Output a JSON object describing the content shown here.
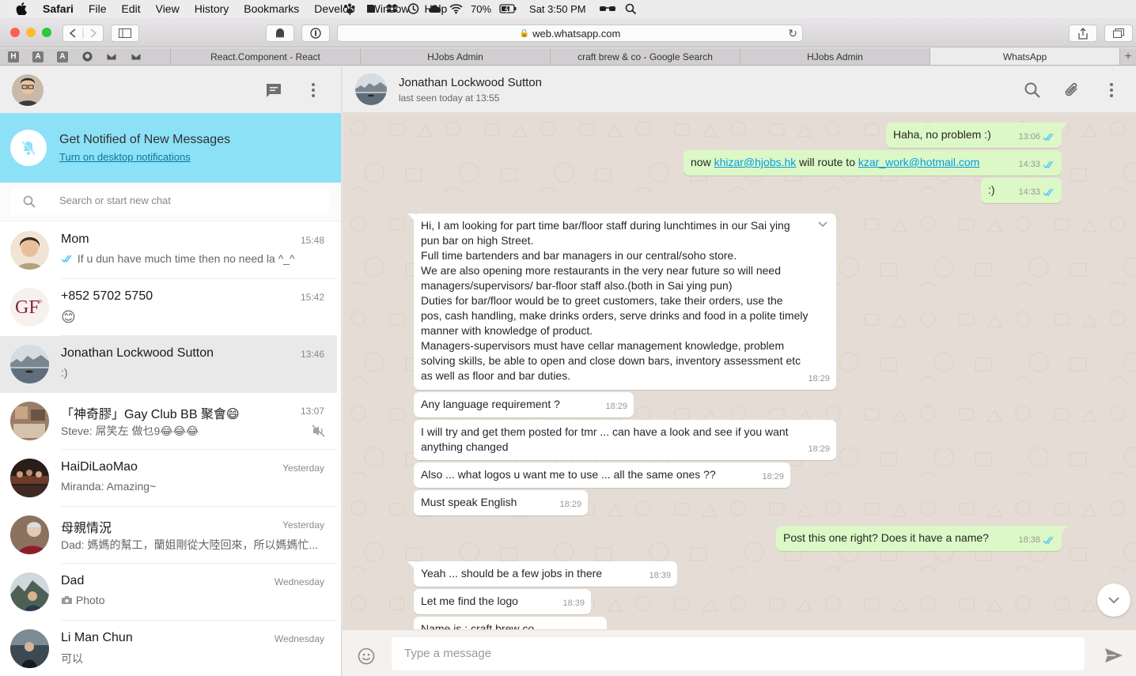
{
  "menubar": {
    "app": "Safari",
    "items": [
      "File",
      "Edit",
      "View",
      "History",
      "Bookmarks",
      "Develop",
      "Window",
      "Help"
    ],
    "battery": "70%",
    "clock": "Sat 3:50 PM"
  },
  "browser": {
    "url": "web.whatsapp.com",
    "pinned_tabs": [
      "H",
      "A",
      "A"
    ],
    "tabs": [
      "React.Component - React",
      "HJobs Admin",
      "craft brew & co - Google Search",
      "HJobs Admin",
      "WhatsApp"
    ],
    "new_tab": "+"
  },
  "sidebar": {
    "notification": {
      "title": "Get Notified of New Messages",
      "link": "Turn on desktop notifications"
    },
    "search_placeholder": "Search or start new chat",
    "chats": [
      {
        "name": "Mom",
        "time": "15:48",
        "preview": "If u dun have much time then no need la ^_^",
        "ticks": true
      },
      {
        "name": "+852 5702 5750",
        "time": "15:42",
        "preview": "😊"
      },
      {
        "name": "Jonathan Lockwood Sutton",
        "time": "13:46",
        "preview": ":)",
        "active": true
      },
      {
        "name": "「神奇膠」Gay Club BB 聚會😄",
        "time": "13:07",
        "preview": "Steve: 屌笑左 做乜9😂😂😂",
        "muted": true
      },
      {
        "name": "HaiDiLaoMao",
        "time": "Yesterday",
        "preview": "Miranda: Amazing~"
      },
      {
        "name": "母親情況",
        "time": "Yesterday",
        "preview": "Dad: 媽媽的幫工，蘭姐剛從大陸回來，所以媽媽忙..."
      },
      {
        "name": "Dad",
        "time": "Wednesday",
        "preview": "Photo",
        "photo": true
      },
      {
        "name": "Li Man Chun",
        "time": "Wednesday",
        "preview": "可以"
      }
    ]
  },
  "conversation": {
    "contact_name": "Jonathan Lockwood Sutton",
    "status": "last seen today at 13:55",
    "messages": {
      "m1": {
        "text": "Haha, no problem :)",
        "time": "13:06"
      },
      "m2": {
        "pre": "now ",
        "link1": "khizar@hjobs.hk",
        "mid": " will route to ",
        "link2": "kzar_work@hotmail.com",
        "time": "14:33"
      },
      "m3": {
        "text": ":)",
        "time": "14:33"
      },
      "m4": {
        "lines": [
          "Hi, I am looking for part time bar/floor staff during lunchtimes in our Sai ying",
          "pun bar on high Street.",
          "Full time bartenders and bar managers in our central/soho store.",
          "We are also opening more restaurants in the very near future so will need",
          "managers/supervisors/ bar-floor staff also.(both in Sai ying pun)",
          "Duties for bar/floor would be to greet customers, take their orders, use the",
          "pos, cash handling, make drinks orders, serve drinks and food in a polite timely",
          "manner with knowledge of product.",
          "Managers-supervisors must have cellar management knowledge, problem",
          "solving skills, be able to open and close down bars, inventory assessment etc",
          "as well as floor and bar duties."
        ],
        "time": "18:29"
      },
      "m5": {
        "text": "Any language requirement ?",
        "time": "18:29"
      },
      "m6": {
        "line1": "I will try and get them posted for tmr ... can have a look and see if you want",
        "line2": "anything changed",
        "time": "18:29"
      },
      "m7": {
        "text": "Also ... what logos u want me to use ... all the same ones ??",
        "time": "18:29"
      },
      "m8": {
        "text": "Must speak English",
        "time": "18:29"
      },
      "m9": {
        "text": "Post this one right? Does it have a name?",
        "time": "18:38"
      },
      "m10": {
        "text": "Yeah ... should be a few jobs in there",
        "time": "18:39"
      },
      "m11": {
        "text": "Let me find the logo",
        "time": "18:39"
      },
      "m12": {
        "text": "Name is : craft brew co"
      }
    },
    "composer_placeholder": "Type a message"
  },
  "colors": {
    "notification_bg": "#8de1f7",
    "outgoing_bubble": "#dcf8c6",
    "incoming_bubble": "#ffffff",
    "chat_bg": "#e5ddd5",
    "tick_blue": "#4fc3f7"
  }
}
